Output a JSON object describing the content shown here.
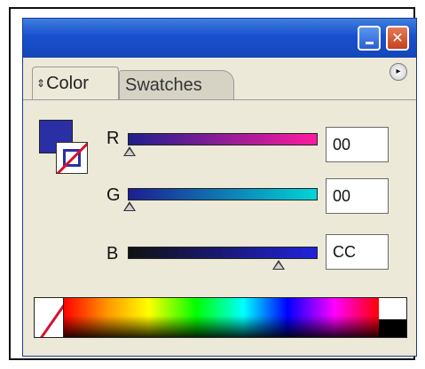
{
  "window": {
    "minimize_icon": "minimize-icon",
    "close_icon": "close-icon",
    "close_glyph": "✕"
  },
  "tabs": {
    "color_label": "Color",
    "color_arrows": "⇕",
    "swatches_label": "Swatches",
    "panel_menu_glyph": "▸"
  },
  "channels": [
    {
      "label": "R",
      "value": "00",
      "level": 0.0,
      "start_color": "#1e1e8e",
      "end_color": "#ff1aa0"
    },
    {
      "label": "G",
      "value": "00",
      "level": 0.0,
      "start_color": "#1d1d90",
      "end_color": "#00d6d6"
    },
    {
      "label": "B",
      "value": "CC",
      "level": 0.8,
      "start_color": "#111111",
      "end_color": "#2222dd"
    }
  ],
  "fill_color": "#2a2fa6",
  "stroke": "none",
  "colors": {
    "titlebar": "#1a4fcf",
    "panel_bg": "#ece9d8",
    "none_slash": "#d7122a"
  }
}
